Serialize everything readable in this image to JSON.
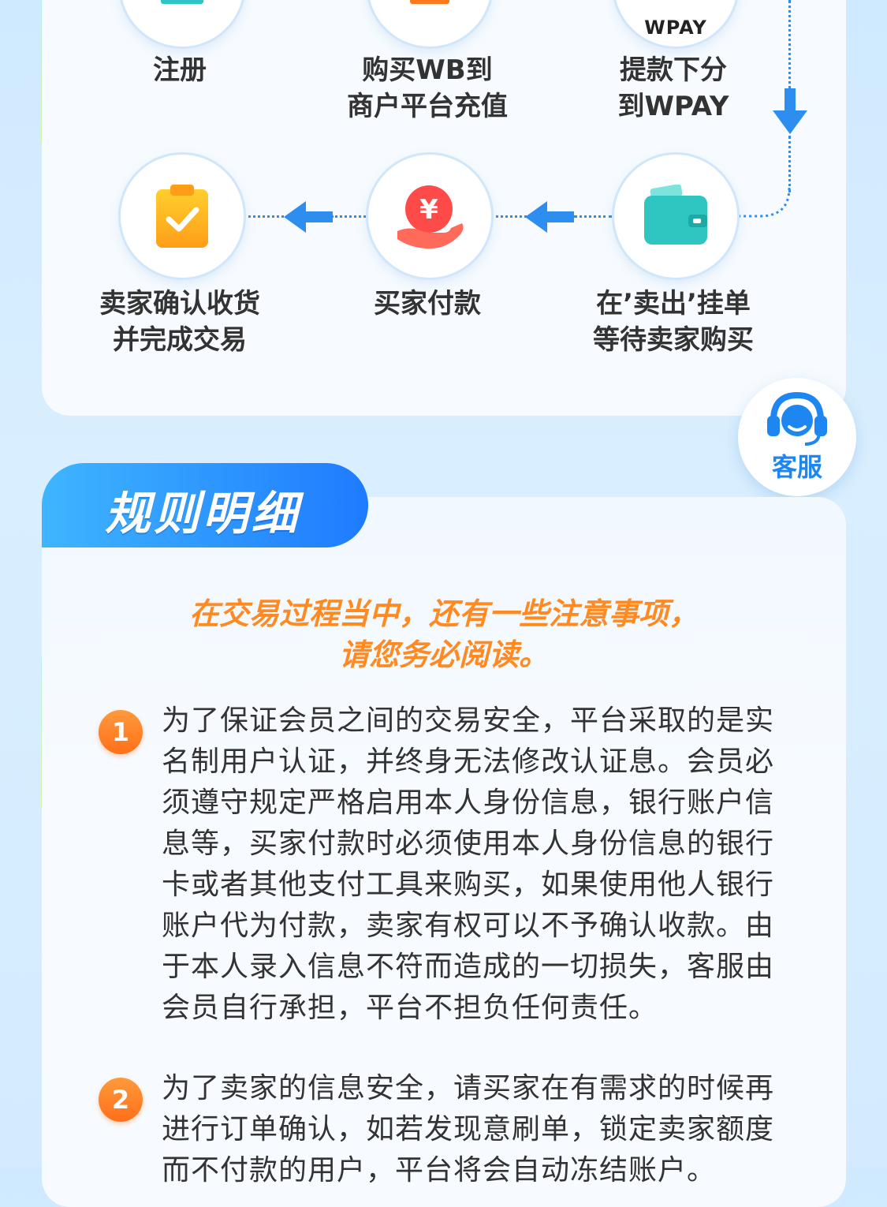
{
  "flow": {
    "row1": [
      {
        "label": "注册"
      },
      {
        "label": "购买WB到\n商户平台充值"
      },
      {
        "label": "提款下分\n到WPAY",
        "badge_text": "WPAY"
      }
    ],
    "row2": [
      {
        "label": "卖家确认收货\n并完成交易",
        "icon": "clipboard-check-icon"
      },
      {
        "label": "买家付款",
        "icon": "yuan-hand-icon",
        "glyph": "¥"
      },
      {
        "label": "在’卖出’挂单\n等待卖家购买",
        "icon": "wallet-icon"
      }
    ]
  },
  "customer_service": {
    "label": "客服",
    "icon": "headset-agent-icon"
  },
  "rules": {
    "title": "规则明细",
    "intro_line1": "在交易过程当中，还有一些注意事项，",
    "intro_line2": "请您务必阅读。",
    "items": [
      {
        "num": "1",
        "text": "为了保证会员之间的交易安全，平台采取的是实名制用户认证，并终身无法修改认证息。会员必须遵守规定严格启用本人身份信息，银行账户信息等，买家付款时必须使用本人身份信息的银行卡或者其他支付工具来购买，如果使用他人银行账户代为付款，卖家有权可以不予确认收款。由于本人录入信息不符而造成的一切损失，客服由会员自行承担，平台不担负任何责任。"
      },
      {
        "num": "2",
        "text": "为了卖家的信息安全，请买家在有需求的时候再进行订单确认，如若发现意刷单，锁定卖家额度而不付款的用户，平台将会自动冻结账户。"
      }
    ]
  },
  "colors": {
    "accent_blue": "#1e86f0",
    "accent_orange": "#ff8a22",
    "teal": "#2fc6c2"
  }
}
